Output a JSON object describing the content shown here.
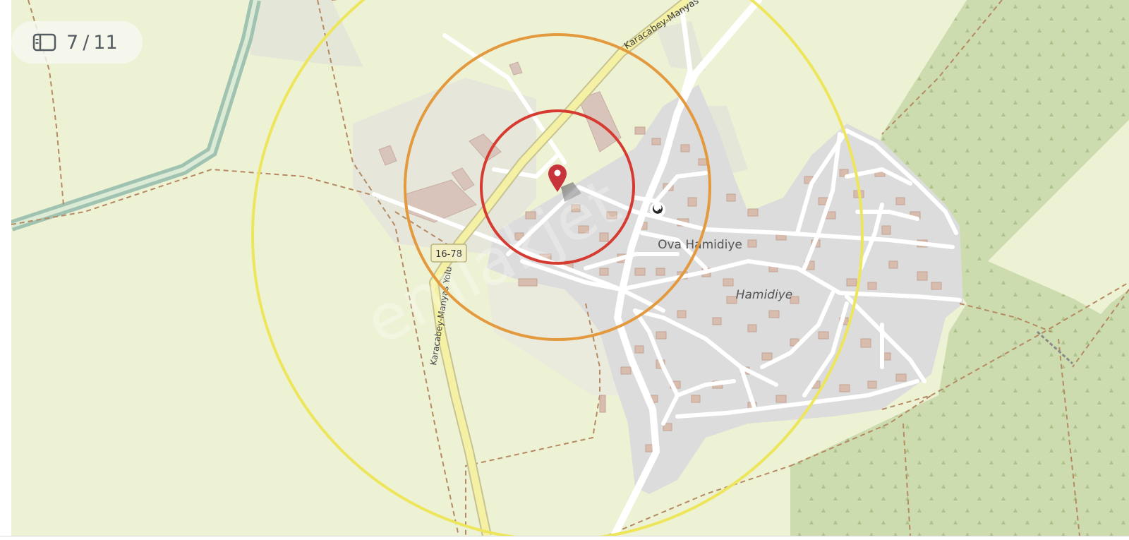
{
  "viewer": {
    "photo_counter": {
      "current": "7",
      "separator": "/",
      "total": "11"
    },
    "icons": {
      "counter": "photo-gallery-icon",
      "pin": "map-pin-icon",
      "mosque": "mosque-icon"
    }
  },
  "map": {
    "labels": {
      "road_north": "Karacabey-Manyas",
      "road_south": "Karacabey-Manyas Yolu",
      "road_shield": "16-78",
      "village": "Ova Hamidiye",
      "locality": "Hamidiye"
    },
    "watermark": "emlakjet",
    "radius_rings": [
      {
        "name": "inner",
        "color": "#d63b32"
      },
      {
        "name": "middle",
        "color": "#e39a3f"
      },
      {
        "name": "outer",
        "color": "#ede65c"
      }
    ],
    "colors": {
      "farmland": "#eef2d5",
      "orchard": "#cddcae",
      "residential": "#dcdcdc",
      "building": "#d4b9ab",
      "road": "#ffffff",
      "main_road": "#f4f1a5",
      "canal": "#9fc3b0",
      "pin": "#c8343b"
    }
  }
}
